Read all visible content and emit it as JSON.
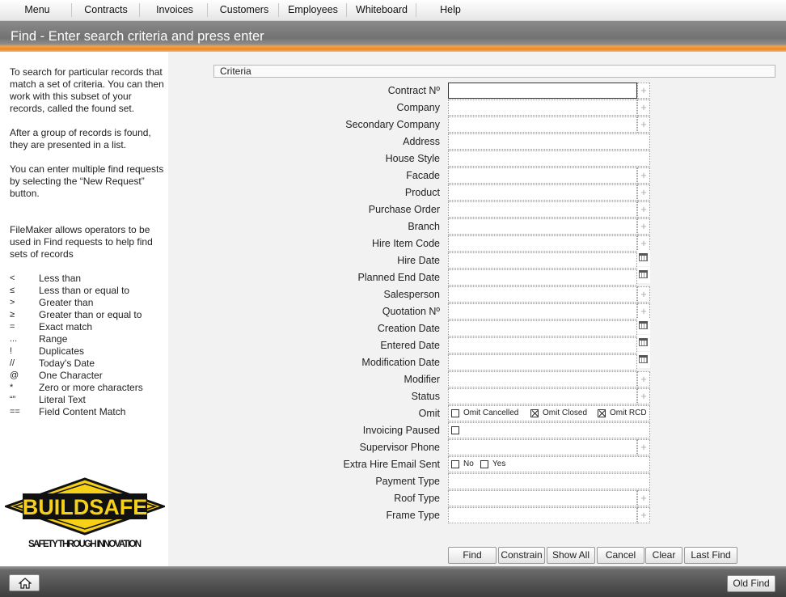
{
  "menu": {
    "items": [
      "Menu",
      "Contracts",
      "Invoices",
      "Customers",
      "Employees",
      "Whiteboard",
      "Help"
    ]
  },
  "title": "Find - Enter search criteria and press enter",
  "help": {
    "paragraphs": [
      "To search for particular records that match a set of criteria. You can then work with this subset of your records, called the found set.",
      "After a group of records is found, they are presented in a list.",
      "You can enter multiple find requests by selecting the “New Request”\nbutton.",
      "FileMaker allows operators to be used in Find requests to help find sets of records"
    ],
    "operators": [
      {
        "symbol": "<",
        "desc": "Less than"
      },
      {
        "symbol": "≤",
        "desc": "Less than or equal to"
      },
      {
        "symbol": ">",
        "desc": "Greater than"
      },
      {
        "symbol": "≥",
        "desc": "Greater than or equal to"
      },
      {
        "symbol": "=",
        "desc": "Exact match"
      },
      {
        "symbol": "...",
        "desc": "Range"
      },
      {
        "symbol": "!",
        "desc": "Duplicates"
      },
      {
        "symbol": "//",
        "desc": "Today's Date"
      },
      {
        "symbol": "@",
        "desc": "One Character"
      },
      {
        "symbol": "*",
        "desc": "Zero or more characters"
      },
      {
        "symbol": "“”",
        "desc": "Literal Text"
      },
      {
        "symbol": "==",
        "desc": "Field Content Match"
      }
    ]
  },
  "logo": {
    "name": "BUILDSAFE",
    "tagline": "SAFETY THROUGH INNOVATION",
    "yellow": "#f7d117",
    "black": "#111111"
  },
  "criteria": {
    "header": "Criteria",
    "fields": [
      {
        "label": "Contract Nº",
        "value": "",
        "button": "plus",
        "active": true
      },
      {
        "label": "Company",
        "value": "",
        "button": "plus"
      },
      {
        "label": "Secondary Company",
        "value": "",
        "button": "plus"
      },
      {
        "label": "Address",
        "value": "",
        "button": "none"
      },
      {
        "label": "House Style",
        "value": "",
        "button": "none"
      },
      {
        "label": "Facade",
        "value": "",
        "button": "plus"
      },
      {
        "label": "Product",
        "value": "",
        "button": "plus"
      },
      {
        "label": "Purchase Order",
        "value": "",
        "button": "plus"
      },
      {
        "label": "Branch",
        "value": "",
        "button": "plus"
      },
      {
        "label": "Hire Item Code",
        "value": "",
        "button": "plus"
      },
      {
        "label": "Hire Date",
        "value": "",
        "button": "calendar"
      },
      {
        "label": "Planned End Date",
        "value": "",
        "button": "calendar"
      },
      {
        "label": "Salesperson",
        "value": "",
        "button": "plus"
      },
      {
        "label": "Quotation Nº",
        "value": "",
        "button": "plus"
      },
      {
        "label": "Creation Date",
        "value": "",
        "button": "calendar"
      },
      {
        "label": "Entered Date",
        "value": "",
        "button": "calendar"
      },
      {
        "label": "Modification Date",
        "value": "",
        "button": "calendar"
      },
      {
        "label": "Modifier",
        "value": "",
        "button": "plus"
      },
      {
        "label": "Status",
        "value": "",
        "button": "plus"
      },
      {
        "label": "Omit",
        "type": "checks",
        "options": [
          {
            "label": "Omit Cancelled",
            "checked": false
          },
          {
            "label": "Omit Closed",
            "checked": true
          },
          {
            "label": "Omit RCD",
            "checked": true
          }
        ]
      },
      {
        "label": "Invoicing Paused",
        "type": "checks",
        "options": [
          {
            "label": "",
            "checked": false
          }
        ]
      },
      {
        "label": "Supervisor Phone",
        "value": "",
        "button": "plus"
      },
      {
        "label": "Extra Hire Email Sent",
        "type": "checks",
        "options": [
          {
            "label": "No",
            "checked": false
          },
          {
            "label": "Yes",
            "checked": false
          }
        ]
      },
      {
        "label": "Payment Type",
        "value": "",
        "button": "none"
      },
      {
        "label": "Roof Type",
        "value": "",
        "button": "plus"
      },
      {
        "label": "Frame Type",
        "value": "",
        "button": "plus"
      }
    ]
  },
  "actions": [
    "Find",
    "Constrain",
    "Show All",
    "Cancel",
    "Clear",
    "Last Find"
  ],
  "bottom": {
    "old_find": "Old Find"
  }
}
